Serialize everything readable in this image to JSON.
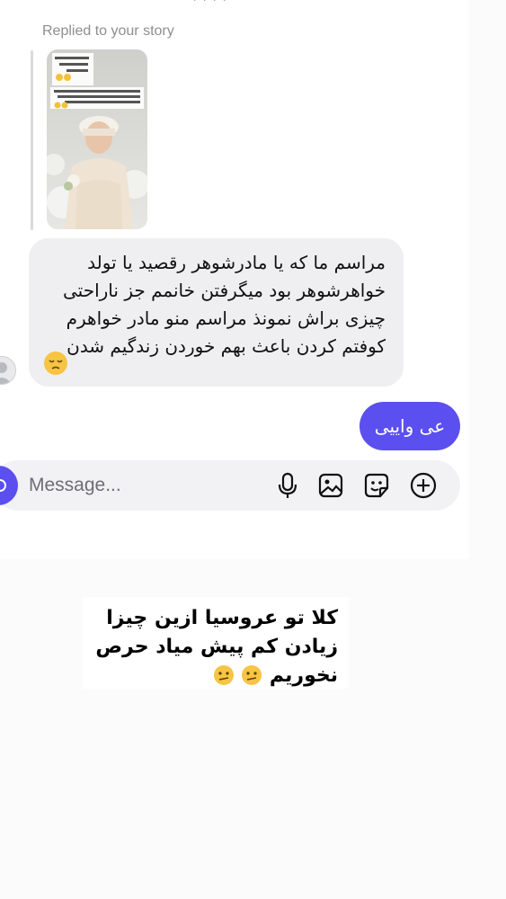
{
  "story_reply": {
    "label": "Replied to your story",
    "thumbnail": "bride-story-photo"
  },
  "messages": [
    {
      "direction": "received",
      "text": "مراسم ما که یا مادرشوهر رقصید یا تولد خواهرشوهر بود میگرفتن خانمم جز ناراحتی چیزی براش نمونذ مراسم منو مادر خواهرم کوفتم کردن باعث بهم خوردن زندگیم شدن",
      "emoji": "pensive-face"
    },
    {
      "direction": "sent",
      "text": "عی واییی"
    }
  ],
  "composer": {
    "placeholder": "Message...",
    "icons": [
      "camera-icon",
      "microphone-icon",
      "gallery-icon",
      "sticker-icon",
      "add-icon"
    ]
  },
  "caption": {
    "text": "کلا تو عروسیا ازین چیزا زیادن کم پیش میاد حرص نخوریم",
    "emoji": "confused-face"
  },
  "colors": {
    "accent": "#5b4ff0",
    "received_bubble": "#efeff2",
    "composer_bg": "#f2f2f4"
  }
}
